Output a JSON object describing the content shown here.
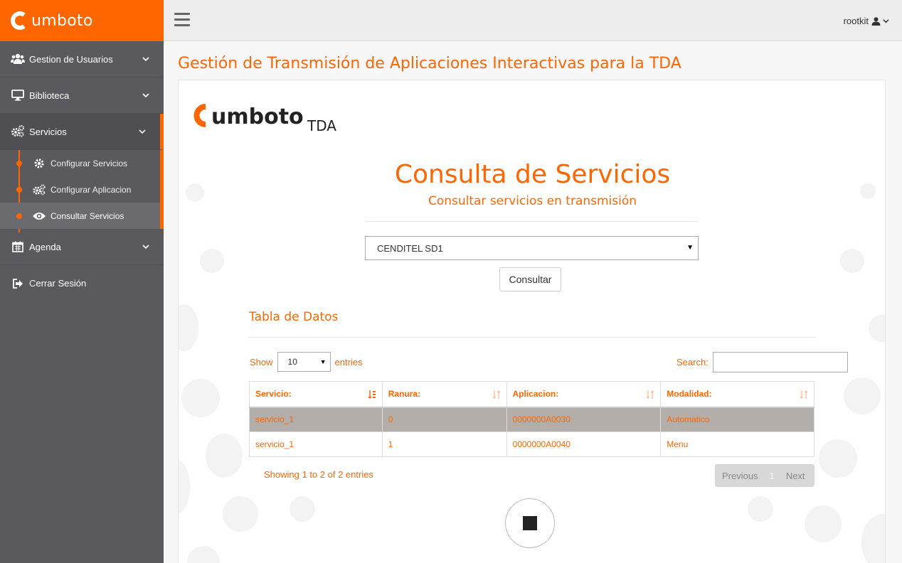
{
  "brand": {
    "name": "umboto",
    "logo_main": "umboto",
    "logo_suffix": "TDA"
  },
  "sidebar": {
    "items": [
      {
        "label": "Gestion de Usuarios",
        "icon": "users-icon"
      },
      {
        "label": "Biblioteca",
        "icon": "desktop-icon"
      },
      {
        "label": "Servicios",
        "icon": "cogs-icon"
      },
      {
        "label": "Agenda",
        "icon": "calendar-icon"
      },
      {
        "label": "Cerrar Sesión",
        "icon": "sign-out-icon"
      }
    ],
    "subitems": [
      {
        "label": "Configurar Servicios",
        "icon": "cog-icon"
      },
      {
        "label": "Configurar Aplicacion",
        "icon": "cogs-icon"
      },
      {
        "label": "Consultar Servicios",
        "icon": "eye-icon"
      }
    ]
  },
  "topbar": {
    "username": "rootkit"
  },
  "page": {
    "title": "Gestión de Transmisión de Aplicaciones Interactivas para la TDA",
    "heading": "Consulta de Servicios",
    "subheading": "Consultar servicios en transmisión",
    "service_selected": "CENDITEL SD1",
    "consult_button": "Consultar",
    "table_title": "Tabla de Datos"
  },
  "table": {
    "length_prefix": "Show",
    "length_value": "10",
    "length_suffix": "entries",
    "search_label": "Search:",
    "search_value": "",
    "headers": [
      "Servicio:",
      "Ranura:",
      "Aplicacion:",
      "Modalidad:"
    ],
    "rows": [
      [
        "servicio_1",
        "0",
        "0000000A0030",
        "Automatico"
      ],
      [
        "servicio_1",
        "1",
        "0000000A0040",
        "Menu"
      ]
    ],
    "info": "Showing 1 to 2 of 2 entries",
    "pager": {
      "previous": "Previous",
      "current": "1",
      "next": "Next"
    }
  },
  "colors": {
    "accent": "#ff6600",
    "sidebar": "#5a5a5e",
    "row_highlight": "#b3aeaa"
  }
}
